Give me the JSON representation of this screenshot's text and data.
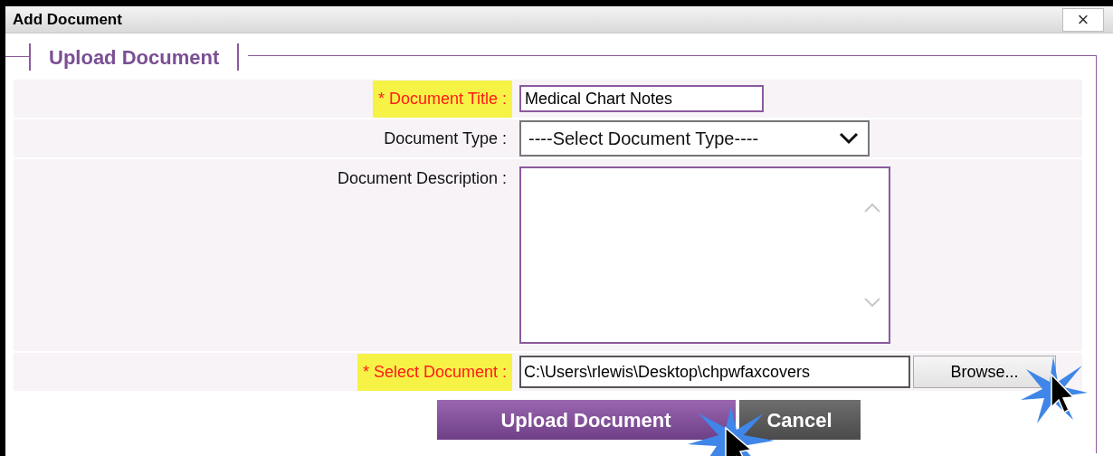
{
  "window": {
    "title": "Add Document",
    "close": "×"
  },
  "section": {
    "legend": "Upload Document"
  },
  "fields": [
    {
      "kind": "text",
      "label": "* Document Title :",
      "required": true,
      "value": "Medical Chart Notes"
    },
    {
      "kind": "select",
      "label": "Document Type :",
      "required": false,
      "value": "----Select Document Type----"
    },
    {
      "kind": "textarea",
      "label": "Document Description :",
      "required": false
    },
    {
      "kind": "file",
      "label": "* Select Document :",
      "required": true,
      "value": "C:\\Users\\rlewis\\Desktop\\chpwfaxcovers",
      "button": "Browse..."
    }
  ],
  "buttons": [
    {
      "label": "Upload Document",
      "kind": "primary"
    },
    {
      "label": "Cancel",
      "kind": "secondary"
    }
  ]
}
